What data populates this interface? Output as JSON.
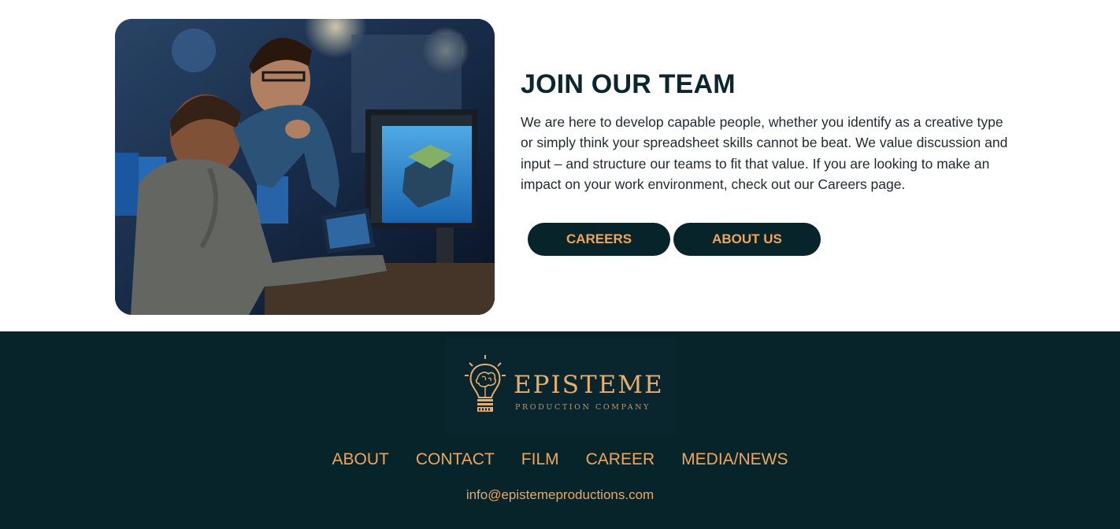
{
  "join": {
    "title": "JOIN OUR TEAM",
    "text": "We are here to develop capable people, whether you identify as a creative type or simply think your spreadsheet skills cannot be beat. We value discussion and input – and structure our teams to fit that value. If you are looking to make an impact on your work environment, check out our Careers page.",
    "buttons": {
      "careers": "CAREERS",
      "about": "ABOUT US"
    },
    "photo_icon": "team-photo"
  },
  "footer": {
    "logo": {
      "name": "EPISTEME",
      "tagline": "PRODUCTION COMPANY",
      "icon": "lightbulb-brain-icon"
    },
    "nav": [
      "ABOUT",
      "CONTACT",
      "FILM",
      "CAREER",
      "MEDIA/NEWS"
    ],
    "email": "info@epistemeproductions.com"
  },
  "colors": {
    "dark_teal": "#07242b",
    "accent_orange": "#f0a65a",
    "heading": "#0c2630"
  }
}
